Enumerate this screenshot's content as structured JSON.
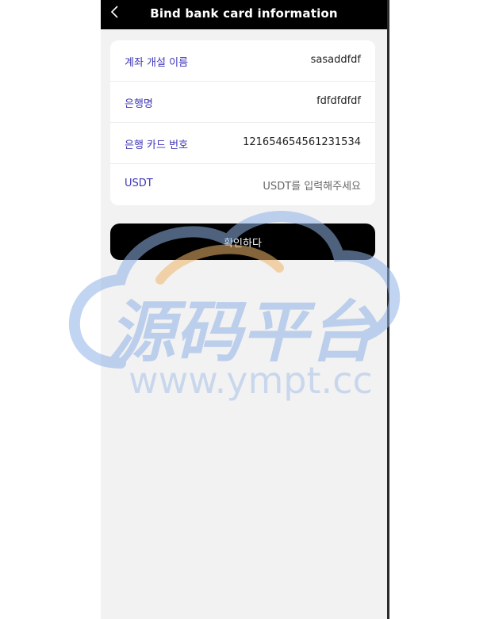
{
  "header": {
    "title": "Bind bank card information"
  },
  "form": {
    "rows": [
      {
        "label": "계좌 개설 이름",
        "value": "sasaddfdf",
        "placeholder": ""
      },
      {
        "label": "은행명",
        "value": "fdfdfdfdf",
        "placeholder": ""
      },
      {
        "label": "은행 카드 번호",
        "value": "121654654561231534",
        "placeholder": ""
      },
      {
        "label": "USDT",
        "value": "",
        "placeholder": "USDT를 입력해주세요"
      }
    ]
  },
  "confirm_label": "확인하다",
  "watermark": {
    "chinese": "源码平台",
    "url": "www.ympt.cc"
  },
  "colors": {
    "header_bg": "#000000",
    "label": "#3e36b7",
    "page_bg": "#f2f2f2",
    "watermark_blue": "#8fb2e6",
    "watermark_orange": "#f0b76a"
  },
  "icons": {
    "back": "chevron-left-icon"
  }
}
